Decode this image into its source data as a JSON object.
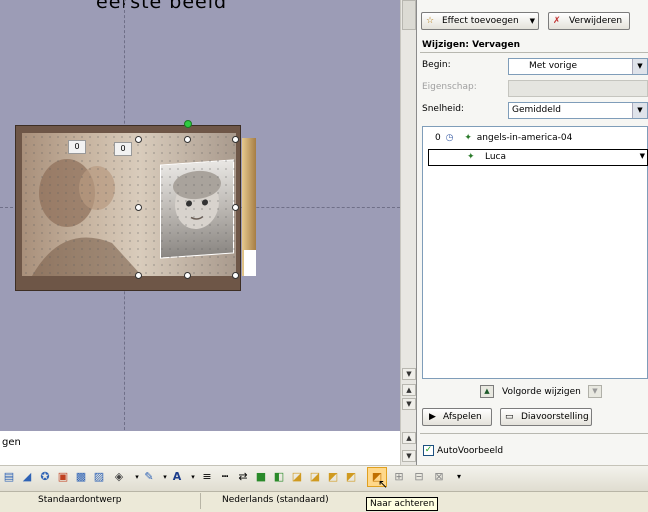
{
  "canvas": {
    "title_fragment": "eerste beeld",
    "tag1": "0",
    "tag2": "0"
  },
  "notes": {
    "text": "gen"
  },
  "task_pane": {
    "add_effect_label": "Effect toevoegen",
    "remove_label": "Verwijderen",
    "section_title": "Wijzigen: Vervagen",
    "begin_label": "Begin:",
    "begin_value": "Met vorige",
    "property_label": "Eigenschap:",
    "property_value": "",
    "speed_label": "Snelheid:",
    "speed_value": "Gemiddeld",
    "list": [
      {
        "index": "0",
        "name": "angels-in-america-04"
      },
      {
        "index": "",
        "name": "Luca"
      }
    ],
    "reorder_label": "Volgorde wijzigen",
    "play_label": "Afspelen",
    "slideshow_label": "Diavoorstelling",
    "autopreview_label": "AutoVoorbeeld",
    "autopreview_checked": true
  },
  "status_bar": {
    "design": "Standaardontwerp",
    "language": "Nederlands (standaard)",
    "tooltip": "Naar achteren"
  },
  "colors": {
    "canvas_bg": "#9c9cb6",
    "frame": "#6e5647",
    "accent_green": "#2ecc40"
  }
}
